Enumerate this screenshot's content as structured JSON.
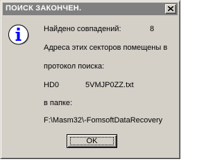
{
  "window": {
    "title": "ПОИСК ЗАКОНЧЕН.",
    "titlebar_color": "#808080",
    "background_color": "#d4d0c8"
  },
  "icons": {
    "message_icon": "info-icon",
    "close_icon": "close-icon"
  },
  "message": {
    "found_label": "Найдено совпадений:",
    "found_count": "8",
    "line_address_1": "Адреса этих секторов помещены в",
    "line_address_2": "протокол поиска:",
    "drive": "HD0",
    "file_name": "5VMJP0ZZ.txt",
    "folder_label": "в папке:",
    "folder_path": "F:\\Masm32\\-FomsoftDataRecovery"
  },
  "buttons": {
    "ok_label": "OK"
  }
}
